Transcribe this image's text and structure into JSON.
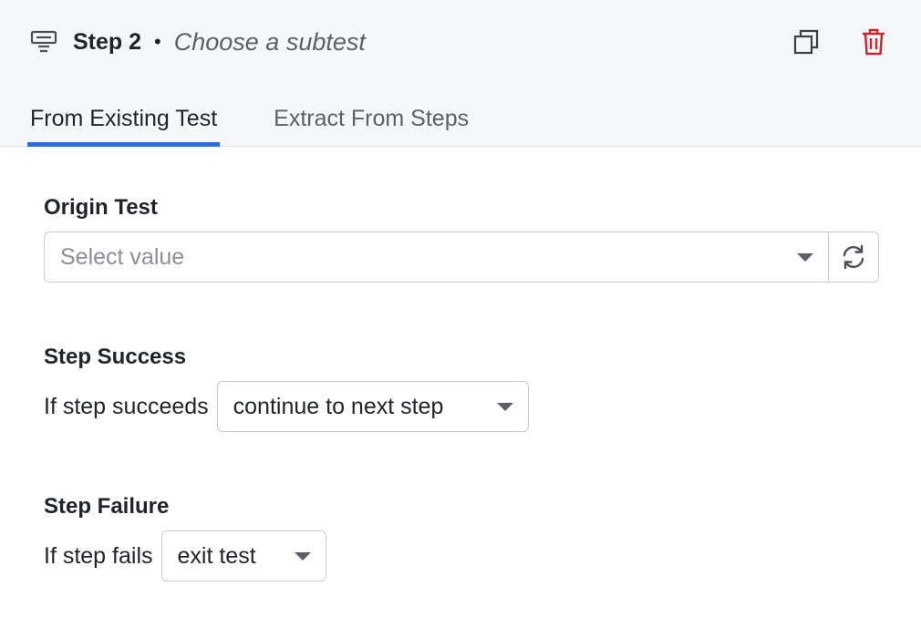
{
  "header": {
    "step_label": "Step 2",
    "separator": "•",
    "subtitle": "Choose a subtest",
    "icons": {
      "step": "subtest-icon",
      "duplicate": "duplicate-icon",
      "delete": "trash-icon"
    },
    "delete_color": "#c6262e"
  },
  "tabs": [
    {
      "label": "From Existing Test",
      "active": true
    },
    {
      "label": "Extract From Steps",
      "active": false
    }
  ],
  "origin": {
    "title": "Origin Test",
    "placeholder": "Select value",
    "refresh_icon": "refresh-icon"
  },
  "success": {
    "title": "Step Success",
    "label": "If step succeeds",
    "value": "continue to next step"
  },
  "failure": {
    "title": "Step Failure",
    "label": "If step fails",
    "value": "exit test"
  },
  "colors": {
    "accent": "#2f6fcf"
  }
}
